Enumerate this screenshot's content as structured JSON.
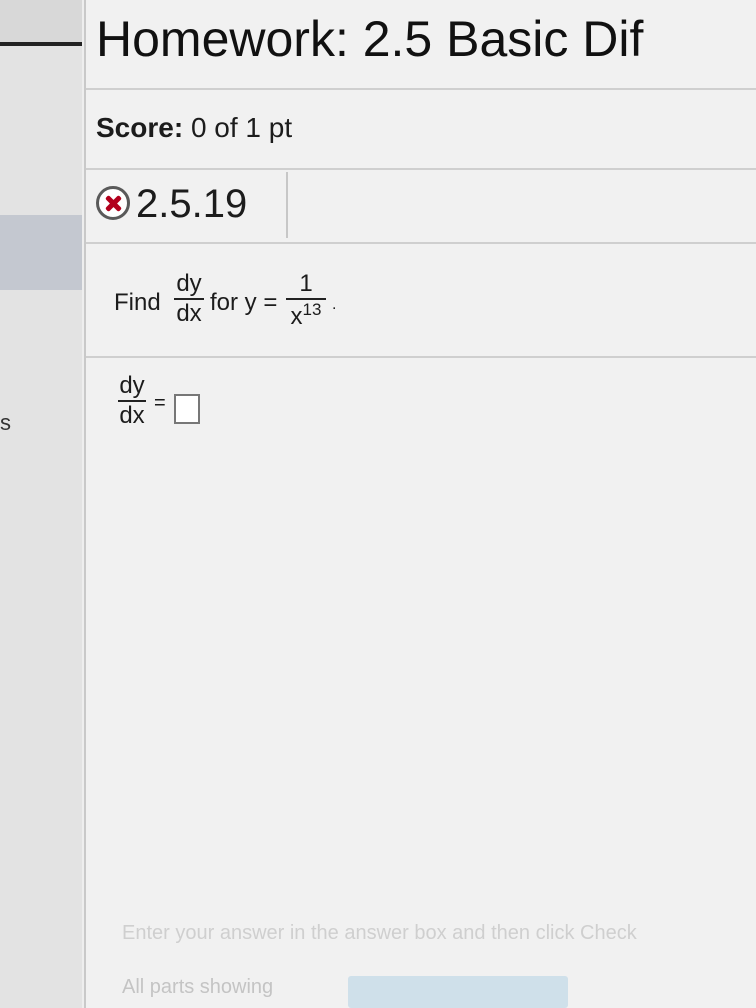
{
  "header": {
    "title": "Homework: 2.5 Basic Dif"
  },
  "score": {
    "label": "Score:",
    "value": "0 of 1 pt"
  },
  "question": {
    "number": "2.5.19",
    "status_icon": "incorrect-x-icon",
    "find_label": "Find",
    "dy": "dy",
    "dx": "dx",
    "for_label": "for y =",
    "numerator": "1",
    "base": "x",
    "exponent": "13",
    "period": "."
  },
  "answer": {
    "dy": "dy",
    "dx": "dx",
    "equals": "=",
    "value": ""
  },
  "footer": {
    "hint": "Enter your answer in the answer box and then click Check",
    "parts": "All parts showing"
  },
  "colors": {
    "incorrect": "#b2001d",
    "background": "#f1f1f1"
  }
}
